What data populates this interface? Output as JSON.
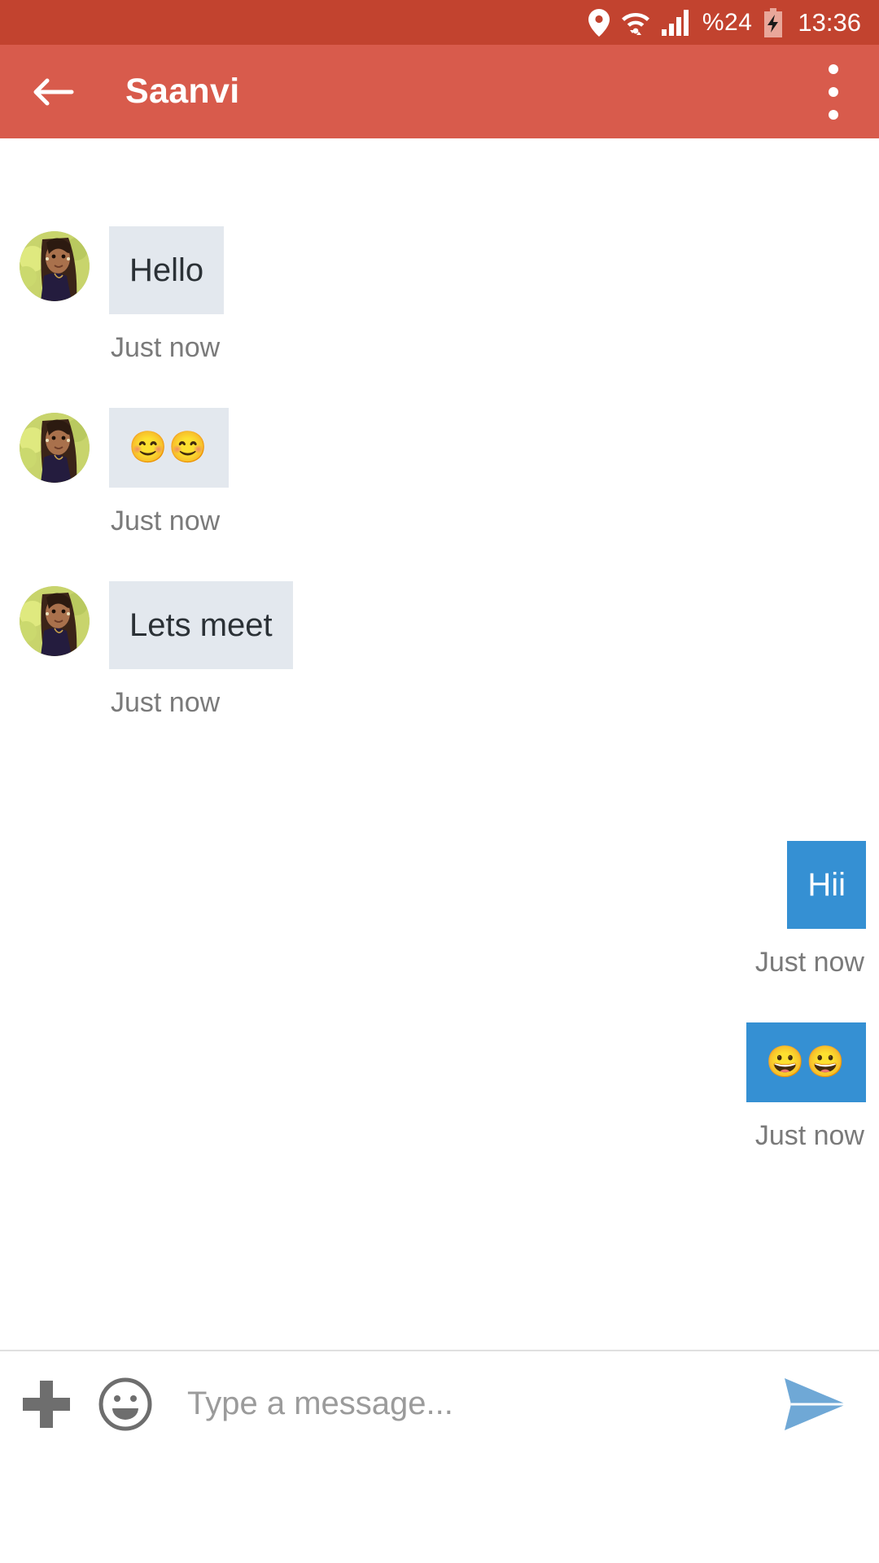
{
  "status_bar": {
    "location_icon": "location-pin-icon",
    "wifi_icon": "wifi-icon",
    "signal_icon": "cellular-signal-icon",
    "battery_percent": "%24",
    "battery_icon": "battery-charging-icon",
    "time": "13:36",
    "background_color": "#C2432F"
  },
  "app_bar": {
    "back_icon": "back-arrow-icon",
    "title": "Saanvi",
    "overflow_icon": "overflow-menu-icon",
    "background_color": "#D85B4C"
  },
  "conversation": {
    "messages": [
      {
        "side": "incoming",
        "text": "Hello",
        "timestamp": "Just now",
        "avatar": "contact-avatar",
        "is_emoji": false
      },
      {
        "side": "incoming",
        "text": "😊😊",
        "timestamp": "Just now",
        "avatar": "contact-avatar",
        "is_emoji": true
      },
      {
        "side": "incoming",
        "text": "Lets meet",
        "timestamp": "Just now",
        "avatar": "contact-avatar",
        "is_emoji": false
      },
      {
        "side": "outgoing",
        "text": "Hii",
        "timestamp": "Just now",
        "is_emoji": false
      },
      {
        "side": "outgoing",
        "text": "😀😀",
        "timestamp": "Just now",
        "is_emoji": true
      }
    ],
    "incoming_bubble_color": "#E3E8EE",
    "outgoing_bubble_color": "#3590D3",
    "timestamp_color": "#7A7A7A"
  },
  "input_bar": {
    "attach_icon": "plus-icon",
    "emoji_icon": "emoji-face-icon",
    "placeholder": "Type a message...",
    "value": "",
    "send_icon": "send-icon",
    "send_color": "#6FA8D6"
  }
}
